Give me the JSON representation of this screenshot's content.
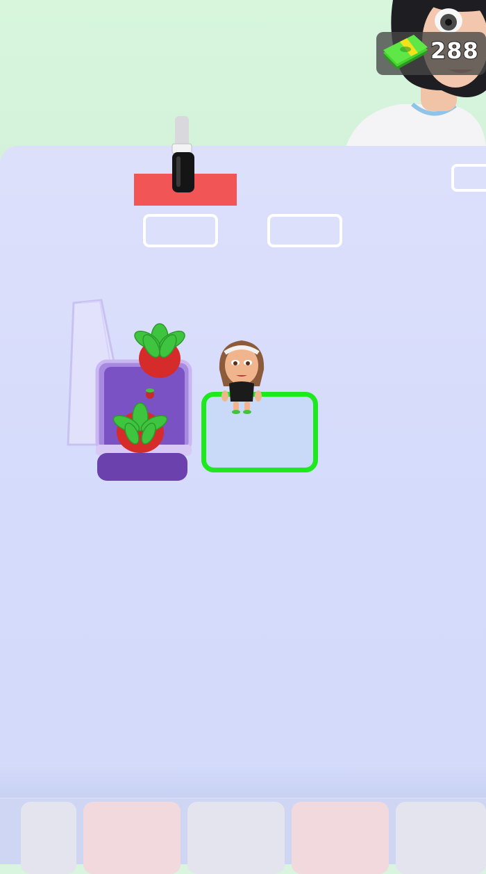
{
  "hud": {
    "cash_icon": "cash-stack-icon",
    "cash_amount": "288"
  },
  "scene": {
    "table_color": "#d8defb",
    "active_pad_color": "#1ee81e",
    "mat_color": "#f25555"
  }
}
